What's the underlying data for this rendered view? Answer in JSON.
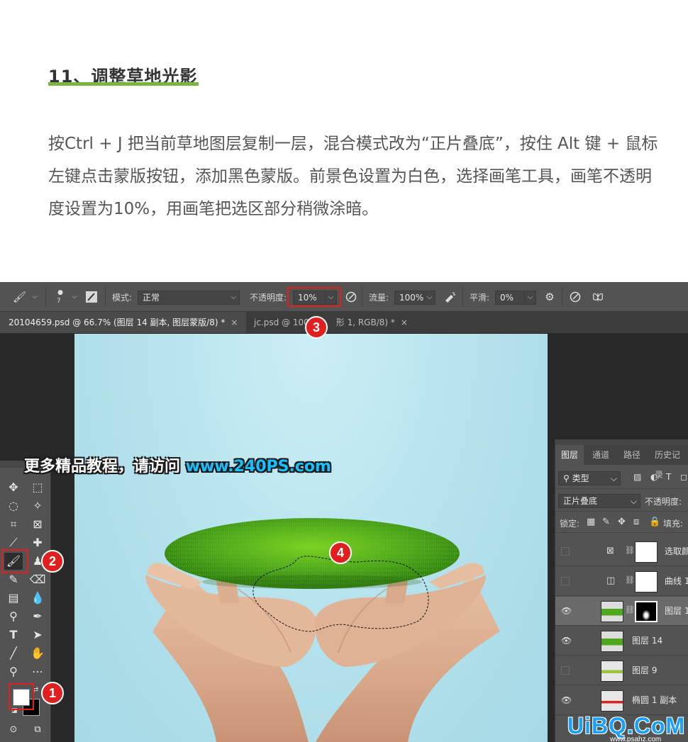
{
  "article": {
    "heading": "11、调整草地光影",
    "paragraph": "按Ctrl + J 把当前草地图层复制一层，混合模式改为“正片叠底”，按住 Alt 键 + 鼠标左键点击蒙版按钮，添加黑色蒙版。前景色设置为白色，选择画笔工具，画笔不透明度设置为10%，用画笔把选区部分稍微涂暗。"
  },
  "options_bar": {
    "brush_size": "7",
    "mode_label": "模式:",
    "mode_value": "正常",
    "opacity_label": "不透明度:",
    "opacity_value": "10%",
    "flow_label": "流量:",
    "flow_value": "100%",
    "smoothing_label": "平滑:",
    "smoothing_value": "0%"
  },
  "tabs": [
    {
      "label": "20104659.psd @ 66.7% (图层 14 副本, 图层蒙版/8) *",
      "close": "×"
    },
    {
      "label": "jc.psd @ 100",
      "label_tail": "形 1, RGB/8) *",
      "close": "×"
    }
  ],
  "banner": {
    "text": "更多精品教程，请访问 ",
    "url": "www.240PS.com"
  },
  "layers_panel": {
    "tabs": [
      "图层",
      "通道",
      "路径",
      "历史记录"
    ],
    "filter_kind": "类型",
    "blend_mode": "正片叠底",
    "opacity_label": "不透明度:",
    "lock_label": "锁定:",
    "fill_label": "填充:",
    "layers": [
      {
        "name": "选取颜",
        "visible": false
      },
      {
        "name": "曲线 1",
        "visible": false
      },
      {
        "name": "图层 1",
        "visible": true
      },
      {
        "name": "图层 14",
        "visible": true
      },
      {
        "name": "图层 9",
        "visible": false
      },
      {
        "name": "椭圆 1 副本",
        "visible": true
      }
    ]
  },
  "callouts": [
    "1",
    "2",
    "3",
    "4"
  ],
  "watermark": {
    "text": "UiBQ.CoM",
    "sub": "www.psahz.com"
  },
  "colors": {
    "accent_green": "#7cb342",
    "callout_red": "#e02020",
    "canvas_sky": "#b3e1ec",
    "grass": "#3f9e1a"
  }
}
